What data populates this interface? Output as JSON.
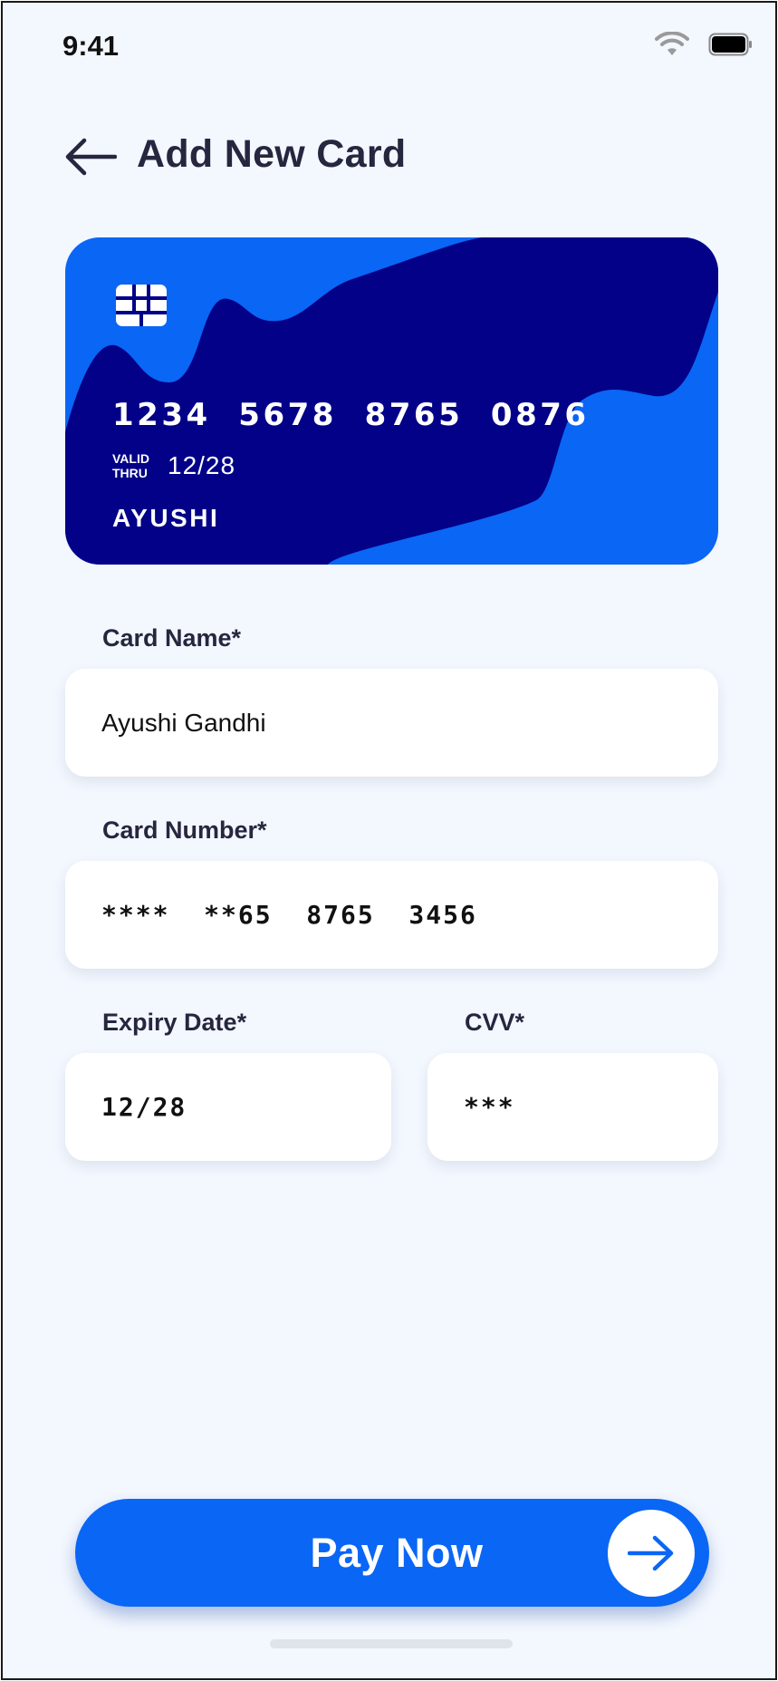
{
  "status_bar": {
    "time": "9:41",
    "icons": [
      "wifi-icon",
      "battery-icon"
    ]
  },
  "header": {
    "back_icon": "arrow-left-icon",
    "title": "Add New Card"
  },
  "card": {
    "number": "1234  5678  8765  0876",
    "valid_thru_label": "VALID THRU",
    "expiry": "12/28",
    "holder": "AYUSHI",
    "colors": {
      "primary": "#0a66f5",
      "dark": "#020188"
    }
  },
  "form": {
    "card_name": {
      "label": "Card Name*",
      "value": "Ayushi Gandhi"
    },
    "card_number": {
      "label": "Card Number*",
      "value": "****  **65  8765  3456"
    },
    "expiry_date": {
      "label": "Expiry Date*",
      "value": "12/28"
    },
    "cvv": {
      "label": "CVV*",
      "value": "***"
    }
  },
  "pay_button": {
    "label": "Pay Now",
    "icon": "arrow-right-icon"
  },
  "theme": {
    "accent": "#0a66f5",
    "background": "#f3f7fe",
    "text": "#26263f"
  }
}
